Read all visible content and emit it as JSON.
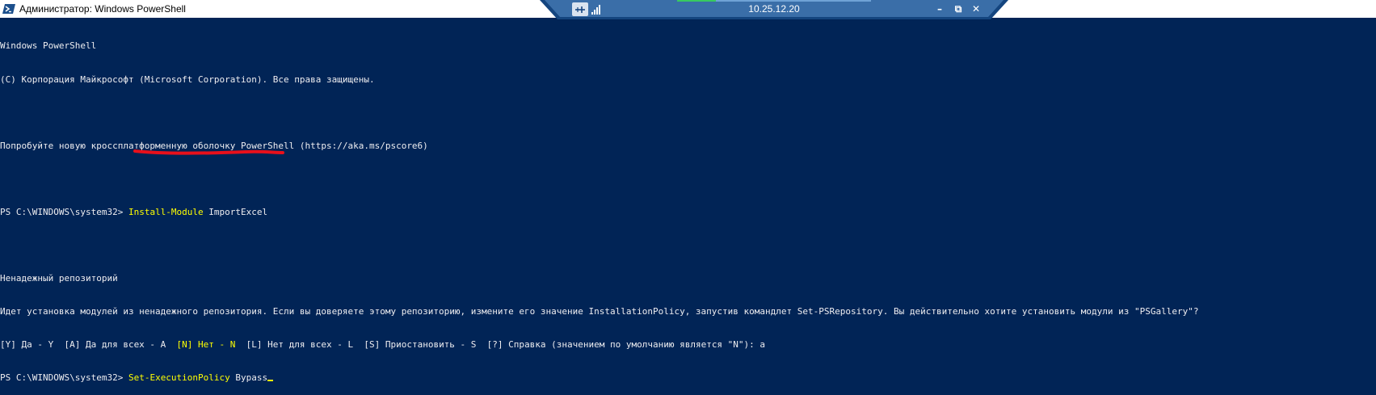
{
  "window": {
    "title": "Администратор: Windows PowerShell",
    "icon": "powershell-icon"
  },
  "rdp": {
    "host": "10.25.12.20",
    "icons": [
      "pin-icon",
      "signal-icon",
      "minimize-icon",
      "restore-icon",
      "close-icon"
    ],
    "minimize_label": "–",
    "restore_label": "⧉",
    "close_label": "✕",
    "progress": 0.2
  },
  "console": {
    "header_line1": "Windows PowerShell",
    "header_line2": "(C) Корпорация Майкрософт (Microsoft Corporation). Все права защищены.",
    "tip_line": "Попробуйте новую кроссплатформенную оболочку PowerShell (https://aka.ms/pscore6)",
    "prompt": "PS C:\\WINDOWS\\system32> ",
    "cmd1_name": "Install-Module",
    "cmd1_args": " ImportExcel",
    "warn_title": "Ненадежный репозиторий",
    "warn_text": "Идет установка модулей из ненадежного репозитория. Если вы доверяете этому репозиторию, измените его значение InstallationPolicy, запустив командлет Set-PSRepository. Вы действительно хотите установить модули из \"PSGallery\"?",
    "choice_y": "[Y] Да - Y  [A] Да для всех - A  ",
    "choice_n": "[N] Нет - N",
    "choice_rest": "  [L] Нет для всех - L  [S] Приостановить - S  [?] Справка (значением по умолчанию является \"N\"): a",
    "cmd2_name": "Set-ExecutionPolicy",
    "cmd2_args": " Bypass",
    "colors": {
      "background": "#012456",
      "text": "#eeedf0",
      "highlight": "#ffff00",
      "annotation": "#e8101b"
    }
  }
}
